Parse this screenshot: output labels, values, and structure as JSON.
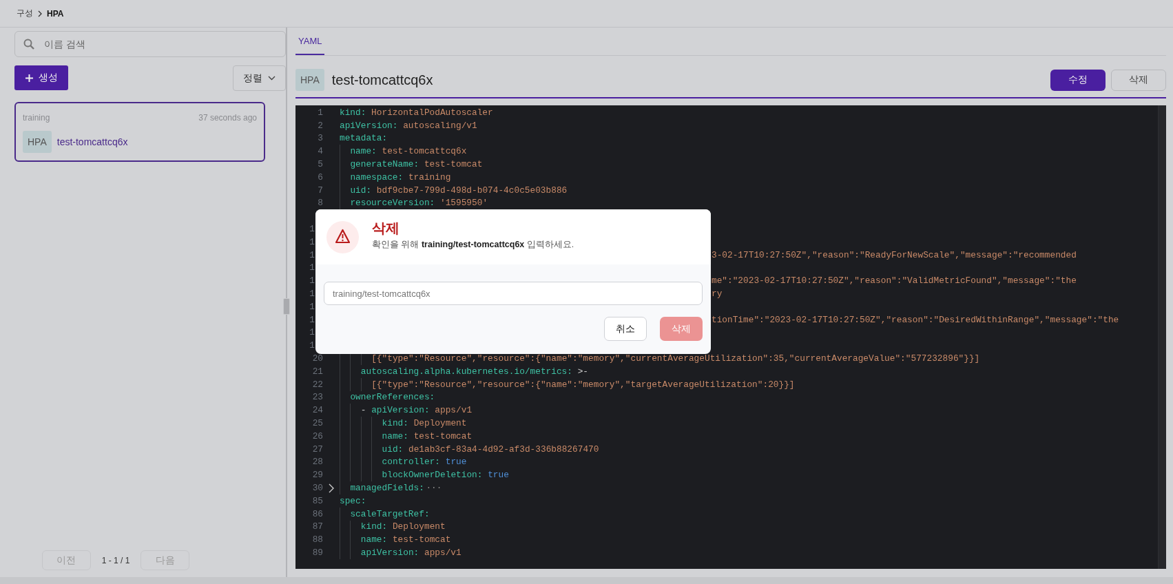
{
  "breadcrumb": [
    {
      "label": "구성"
    },
    {
      "label": "HPA"
    }
  ],
  "sidebar": {
    "search": {
      "placeholder": "이름 검색"
    },
    "create_button": {
      "label": "생성"
    },
    "sort_button": {
      "label": "정렬"
    },
    "items": [
      {
        "namespace": "training",
        "age": "37 seconds ago",
        "badge": "HPA",
        "name": "test-tomcattcq6x",
        "selected": true
      }
    ],
    "pagination": {
      "prev": {
        "label": "이전",
        "disabled": true
      },
      "range": "1 - 1 / 1",
      "next": {
        "label": "다음",
        "disabled": true
      }
    }
  },
  "detail": {
    "tabs": [
      {
        "label": "YAML",
        "selected": true
      }
    ],
    "badge": "HPA",
    "title": "test-tomcattcq6x",
    "buttons": [
      {
        "label": "수정",
        "kind": "primary"
      },
      {
        "label": "삭제",
        "kind": "secondary"
      }
    ],
    "editor": {
      "lines": [
        {
          "kind": "string",
          "number": "1",
          "key": "kind:",
          "value": "HorizontalPodAutoscaler"
        },
        {
          "kind": "string",
          "number": "2",
          "key": "apiVersion:",
          "value": "autoscaling/v1"
        },
        {
          "kind": "key",
          "number": "3",
          "key": "metadata:",
          "children": [
            {
              "kind": "string",
              "number": "4",
              "key": "name:",
              "value": "test-tomcattcq6x"
            },
            {
              "kind": "string",
              "number": "5",
              "key": "generateName:",
              "value": "test-tomcat"
            },
            {
              "kind": "string",
              "number": "6",
              "key": "namespace:",
              "value": "training"
            },
            {
              "kind": "string",
              "number": "7",
              "key": "uid:",
              "value": "bdf9cbe7-799d-498d-b074-4c0c5e03b886"
            },
            {
              "kind": "string",
              "number": "8",
              "key": "resourceVersion:",
              "value": "'1595950'"
            },
            {
              "kind": "covered"
            },
            {
              "kind": "covered",
              "number": "1",
              "children": [
                {
                  "kind": "covered",
                  "number": "1"
                },
                {
                  "kind": "covered",
                  "number": "1",
                  "tail": "3-02-17T10:27:50Z\",\"reason\":\"ReadyForNewScale\",\"message\":\"recommended"
                },
                {
                  "kind": "covered",
                  "number": "1"
                },
                {
                  "kind": "covered",
                  "number": "1",
                  "tail": "me\":\"2023-02-17T10:27:50Z\",\"reason\":\"ValidMetricFound\",\"message\":\"the"
                },
                {
                  "kind": "covered",
                  "number": "1",
                  "tail": "ry"
                },
                {
                  "kind": "covered",
                  "number": "1"
                },
                {
                  "kind": "covered",
                  "number": "1",
                  "tail": "tionTime\":\"2023-02-17T10:27:50Z\",\"reason\":\"DesiredWithinRange\",\"message\":\"the"
                },
                {
                  "kind": "covered",
                  "number": "1"
                },
                {
                  "kind": "covered",
                  "number": "1",
                  "children": [
                    {
                      "kind": "string",
                      "number": "20",
                      "value": "[{\"type\":\"Resource\",\"resource\":{\"name\":\"memory\",\"currentAverageUtilization\":35,\"currentAverageValue\":\"577232896\"}}]"
                    }
                  ]
                },
                {
                  "kind": "plain",
                  "number": "21",
                  "key": "autoscaling.alpha.kubernetes.io/metrics:",
                  "value": ">-",
                  "children": [
                    {
                      "kind": "string",
                      "number": "22",
                      "value": "[{\"type\":\"Resource\",\"resource\":{\"name\":\"memory\",\"targetAverageUtilization\":20}}]"
                    }
                  ]
                }
              ]
            },
            {
              "kind": "key",
              "number": "23",
              "key": "ownerReferences:",
              "children": [
                {
                  "kind": "string",
                  "number": "24",
                  "bullet": "-",
                  "key": "apiVersion:",
                  "value": "apps/v1",
                  "children": [
                    {
                      "kind": "string",
                      "number": "25",
                      "key": "kind:",
                      "value": "Deployment"
                    },
                    {
                      "kind": "string",
                      "number": "26",
                      "key": "name:",
                      "value": "test-tomcat"
                    },
                    {
                      "kind": "string",
                      "number": "27",
                      "key": "uid:",
                      "value": "de1ab3cf-83a4-4d92-af3d-336b88267470"
                    },
                    {
                      "kind": "bool",
                      "number": "28",
                      "key": "controller:",
                      "value": "true"
                    },
                    {
                      "kind": "bool",
                      "number": "29",
                      "key": "blockOwnerDeletion:",
                      "value": "true"
                    }
                  ]
                }
              ]
            },
            {
              "kind": "fold",
              "number": "30",
              "key": "managedFields:",
              "value": "···"
            }
          ]
        },
        {
          "kind": "key",
          "number": "85",
          "key": "spec:",
          "children": [
            {
              "kind": "key",
              "number": "86",
              "key": "scaleTargetRef:",
              "children": [
                {
                  "kind": "string",
                  "number": "87",
                  "key": "kind:",
                  "value": "Deployment"
                },
                {
                  "kind": "string",
                  "number": "88",
                  "key": "name:",
                  "value": "test-tomcat"
                },
                {
                  "kind": "string",
                  "number": "89",
                  "key": "apiVersion:",
                  "value": "apps/v1"
                }
              ]
            }
          ]
        }
      ]
    }
  },
  "dialog": {
    "title": "삭제",
    "message": "확인을 위해 **training/test-tomcattcq6x** 입력하세요.",
    "input": {
      "placeholder": "training/test-tomcattcq6x"
    },
    "buttons": [
      {
        "label": "취소",
        "kind": "secondary",
        "disabled": false
      },
      {
        "label": "삭제",
        "kind": "danger",
        "disabled": true
      }
    ]
  }
}
